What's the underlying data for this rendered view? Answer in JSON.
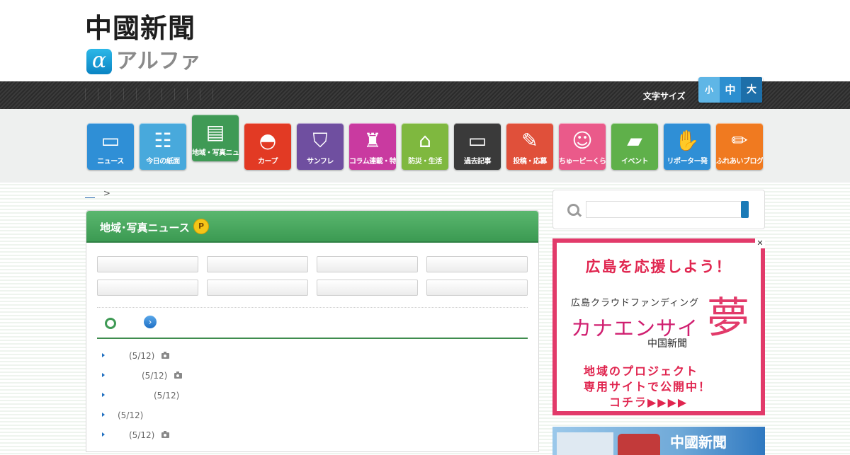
{
  "logo": {
    "title": "中國新聞",
    "alpha_mark": "α",
    "alpha_text": "アルファ"
  },
  "utility": {
    "font_size_label": "文字サイズ",
    "sizes": [
      "小",
      "中",
      "大"
    ]
  },
  "nav": {
    "items": [
      {
        "label": "ニュース",
        "icon": "monitor-icon",
        "glyph": "▭",
        "color": "#2f8fd6"
      },
      {
        "label": "今日の紙面",
        "icon": "reader-icon",
        "glyph": "☷",
        "color": "#48a9dc"
      },
      {
        "label": "地域・写真ニュース",
        "icon": "newspaper-icon",
        "glyph": "▤",
        "color": "#3f9a55",
        "active": true
      },
      {
        "label": "カープ",
        "icon": "cap-icon",
        "glyph": "◓",
        "color": "#e23a24"
      },
      {
        "label": "サンフレ",
        "icon": "shield-icon",
        "glyph": "⛉",
        "color": "#6f4fa0"
      },
      {
        "label": "コラム連載・特集",
        "icon": "helmet-icon",
        "glyph": "♜",
        "color": "#c93aa0"
      },
      {
        "label": "防災・生活",
        "icon": "house-icon",
        "glyph": "⌂",
        "color": "#7fb83f"
      },
      {
        "label": "過去記事",
        "icon": "folder-icon",
        "glyph": "▭",
        "color": "#3a3a3a"
      },
      {
        "label": "投稿・応募",
        "icon": "pen-paper-icon",
        "glyph": "✎",
        "color": "#e0503a"
      },
      {
        "label": "ちゅーピーくらぶ",
        "icon": "mascot-icon",
        "glyph": "☺",
        "color": "#ea5a8a"
      },
      {
        "label": "イベント",
        "icon": "shoe-icon",
        "glyph": "▰",
        "color": "#5fb04a"
      },
      {
        "label": "リポーター発",
        "icon": "hand-icon",
        "glyph": "✋",
        "color": "#2f8fd6"
      },
      {
        "label": "ふれあいブログ",
        "icon": "pencil-icon",
        "glyph": "✏",
        "color": "#f07a20"
      }
    ]
  },
  "breadcrumb": {
    "separator": ">"
  },
  "panel": {
    "title": "地域･写真ニュース",
    "badge": "P",
    "news": [
      {
        "date": "(5/12)",
        "photo": true
      },
      {
        "date": "(5/12)",
        "photo": true
      },
      {
        "date": "(5/12)",
        "photo": false
      },
      {
        "date": "(5/12)",
        "photo": false
      },
      {
        "date": "(5/12)",
        "photo": true
      }
    ]
  },
  "ad": {
    "close": "✕",
    "line1": "広島を応援しよう！",
    "line2": "広島クラウドファンディング",
    "line3": "カナエンサイ",
    "yume": "夢",
    "line4": "中国新聞",
    "line5": "地域のプロジェクト",
    "line6": "専用サイトで公開中！",
    "line7": "コチラ▶▶▶▶"
  },
  "bottom_banner": {
    "title": "中國新聞"
  }
}
